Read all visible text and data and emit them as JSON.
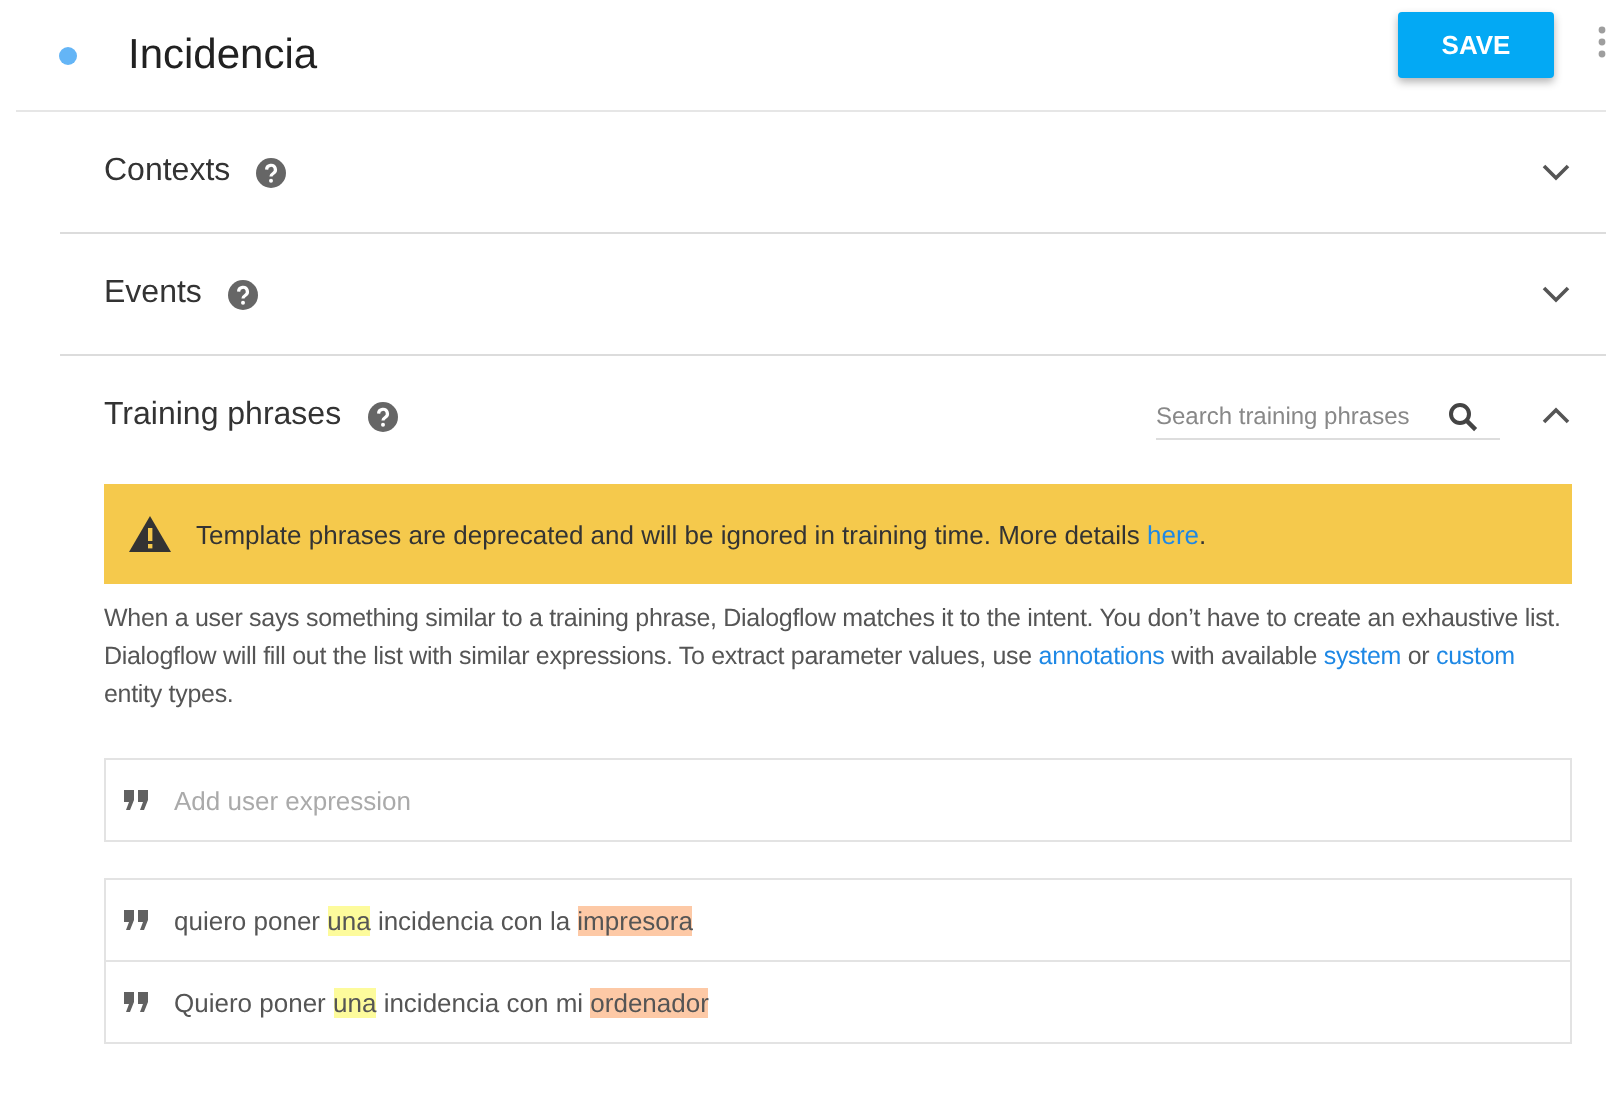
{
  "intent": {
    "title": "Incidencia",
    "save_label": "SAVE"
  },
  "sections": [
    {
      "title": "Contexts",
      "expanded": false
    },
    {
      "title": "Events",
      "expanded": false
    },
    {
      "title": "Training phrases",
      "expanded": true
    }
  ],
  "training": {
    "search": {
      "placeholder": "Search training phrases"
    },
    "banner": [
      {
        "text": "Template phrases are deprecated and will be ignored in training time. More details "
      },
      {
        "text": "here",
        "kind": "link"
      },
      {
        "text": "."
      }
    ],
    "description": [
      {
        "text": "When a user says something similar to a training phrase, Dialogflow matches it to the intent. You don’t have to create an exhaustive list. Dialogflow will fill out the list with similar expressions. To extract parameter values, use "
      },
      {
        "text": "annotations",
        "kind": "link"
      },
      {
        "text": " with available "
      },
      {
        "text": "system",
        "kind": "link"
      },
      {
        "text": " or "
      },
      {
        "text": "custom",
        "kind": "link"
      },
      {
        "text": " entity types."
      }
    ],
    "input": {
      "placeholder": "Add user expression"
    },
    "phrases": [
      {
        "segments": [
          {
            "text": "quiero poner "
          },
          {
            "text": "una",
            "color": "#fdfb9c"
          },
          {
            "text": " incidencia con la "
          },
          {
            "text": "impresora",
            "color": "#fdc9a6"
          }
        ]
      },
      {
        "segments": [
          {
            "text": "Quiero poner "
          },
          {
            "text": "una",
            "color": "#fdfb9c"
          },
          {
            "text": " incidencia con mi "
          },
          {
            "text": "ordenador",
            "color": "#fdc9a6"
          }
        ]
      }
    ]
  }
}
